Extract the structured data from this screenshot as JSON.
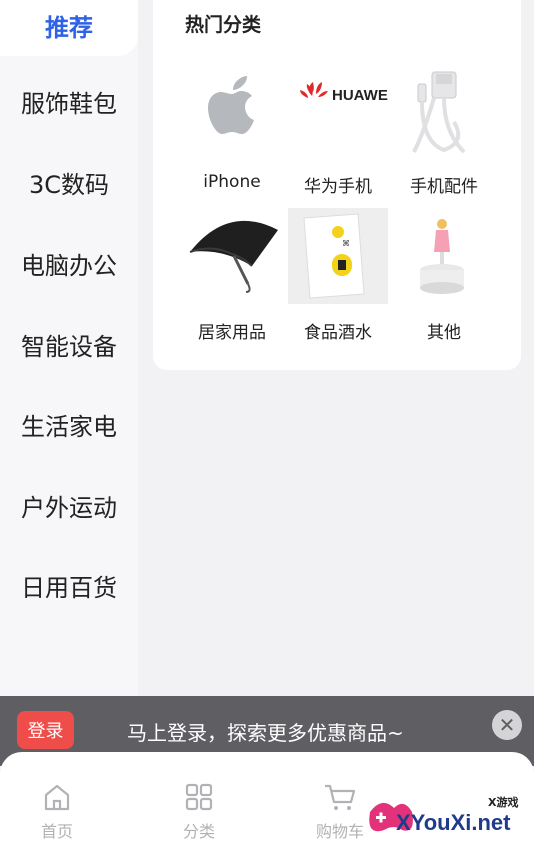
{
  "sidebar": {
    "items": [
      {
        "label": "推荐"
      },
      {
        "label": "服饰鞋包"
      },
      {
        "label": "3C数码"
      },
      {
        "label": "电脑办公"
      },
      {
        "label": "智能设备"
      },
      {
        "label": "生活家电"
      },
      {
        "label": "户外运动"
      },
      {
        "label": "日用百货"
      }
    ]
  },
  "main": {
    "section_title": "热门分类",
    "categories": [
      {
        "label": "iPhone",
        "icon": "apple-logo-icon"
      },
      {
        "label": "华为手机",
        "icon": "huawei-logo-icon",
        "logo_text": "HUAWEI"
      },
      {
        "label": "手机配件",
        "icon": "usb-cable-icon"
      },
      {
        "label": "居家用品",
        "icon": "umbrella-icon"
      },
      {
        "label": "食品酒水",
        "icon": "snack-bag-icon"
      },
      {
        "label": "其他",
        "icon": "figurine-icon"
      }
    ]
  },
  "banner": {
    "login_label": "登录",
    "text": "马上登录，探索更多优惠商品~",
    "close_label": "✕"
  },
  "bottom_nav": {
    "items": [
      {
        "label": "首页",
        "icon": "home-icon"
      },
      {
        "label": "分类",
        "icon": "grid-icon"
      },
      {
        "label": "购物车",
        "icon": "cart-icon"
      }
    ]
  },
  "watermark": {
    "text": "XYouXi.net",
    "small": "X游戏"
  },
  "colors": {
    "accent": "#2f63e6",
    "login": "#ee4d4a",
    "banner_bg": "#5f5f63"
  }
}
